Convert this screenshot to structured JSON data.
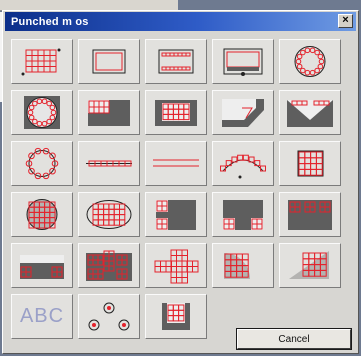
{
  "window": {
    "title": "Punched m    os",
    "close_glyph": "×"
  },
  "buttons": {
    "cancel_label": "Cancel"
  },
  "tiles": [
    "rect-grid",
    "rect-outline",
    "rect-perimeter",
    "rect-sides-dot",
    "circle-perimeter",
    "circle-perimeter-dark",
    "rect-grid-corner",
    "rect-grid-center",
    "shape-corner-cut",
    "shape-v-notch",
    "circle-ring",
    "line-dashed",
    "line-double",
    "arc-holes",
    "square-grid",
    "circle-grid",
    "rect-grid-oval",
    "rect-corner-squares",
    "rect-corner-two",
    "rect-top-squares",
    "rect-side-squares",
    "rect-grid-blocks",
    "cross-grid",
    "quarter-circle-grid",
    "triangle-grid",
    "text-abc",
    "three-dots",
    "u-shape"
  ],
  "text_tile_label": "ABC",
  "colors": {
    "hole": "#e4222c",
    "line": "#222222",
    "fill": "#5e5e5e",
    "tile": "#e2e1de"
  }
}
